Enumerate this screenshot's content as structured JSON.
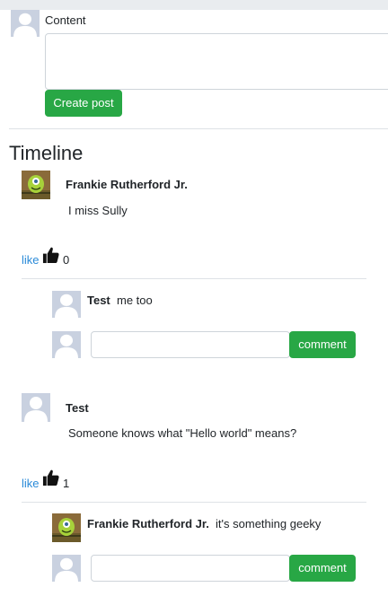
{
  "create_post": {
    "content_label": "Content",
    "content_value": "",
    "submit_label": "Create post"
  },
  "timeline": {
    "title": "Timeline",
    "posts": [
      {
        "author": "Frankie Rutherford Jr.",
        "body": "I miss Sully",
        "avatar": "photo-avatar",
        "like_label": "like",
        "like_icon": "thumbs-up-icon",
        "like_count": "0",
        "comments": [
          {
            "author": "Test",
            "text": "me too",
            "avatar": "default-avatar"
          }
        ],
        "comment_input_value": "",
        "comment_button_label": "comment"
      },
      {
        "author": "Test",
        "body": "Someone knows what \"Hello world\" means?",
        "avatar": "default-avatar",
        "like_label": "like",
        "like_icon": "thumbs-up-icon",
        "like_count": "1",
        "comments": [
          {
            "author": "Frankie Rutherford Jr.",
            "text": "it's something geeky",
            "avatar": "photo-avatar"
          }
        ],
        "comment_input_value": "",
        "comment_button_label": "comment"
      }
    ]
  },
  "colors": {
    "accent_green": "#28a745",
    "link_blue": "#2a8ad8",
    "placeholder_avatar": "#c9d1e0"
  }
}
